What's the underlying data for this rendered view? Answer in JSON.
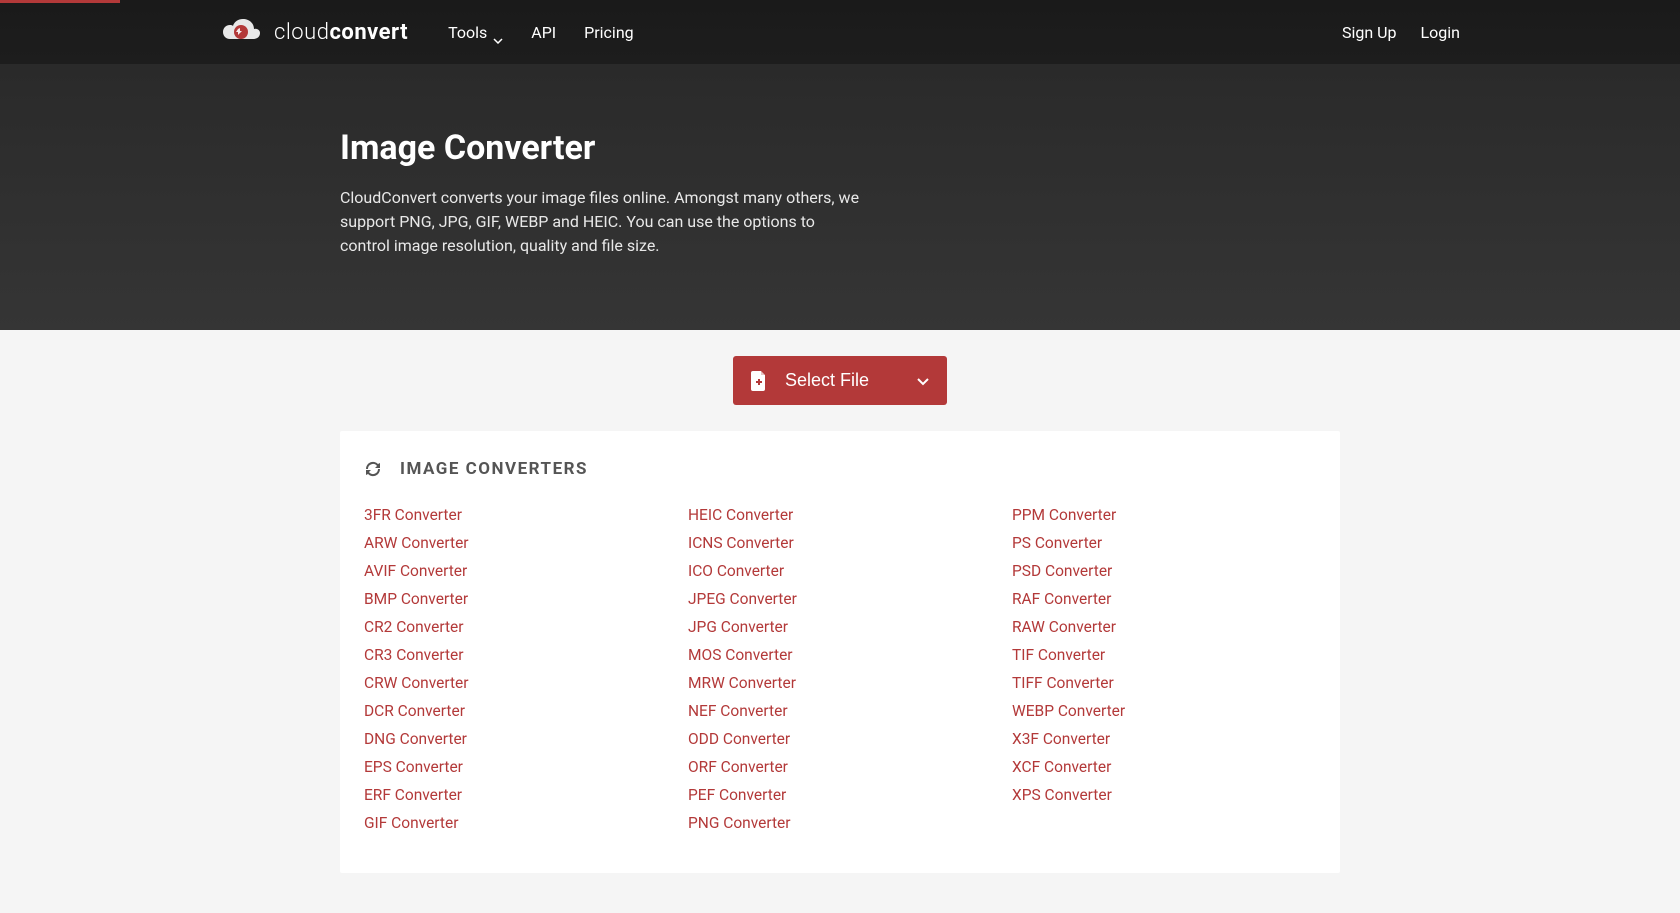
{
  "brand": {
    "light": "cloud",
    "bold": "convert"
  },
  "nav": {
    "tools": "Tools",
    "api": "API",
    "pricing": "Pricing",
    "signup": "Sign Up",
    "login": "Login"
  },
  "hero": {
    "title": "Image Converter",
    "description": "CloudConvert converts your image files online. Amongst many others, we support PNG, JPG, GIF, WEBP and HEIC. You can use the options to control image resolution, quality and file size."
  },
  "selectFile": "Select File",
  "section": {
    "title": "IMAGE CONVERTERS"
  },
  "converters": {
    "col1": [
      "3FR Converter",
      "ARW Converter",
      "AVIF Converter",
      "BMP Converter",
      "CR2 Converter",
      "CR3 Converter",
      "CRW Converter",
      "DCR Converter",
      "DNG Converter",
      "EPS Converter",
      "ERF Converter",
      "GIF Converter"
    ],
    "col2": [
      "HEIC Converter",
      "ICNS Converter",
      "ICO Converter",
      "JPEG Converter",
      "JPG Converter",
      "MOS Converter",
      "MRW Converter",
      "NEF Converter",
      "ODD Converter",
      "ORF Converter",
      "PEF Converter",
      "PNG Converter"
    ],
    "col3": [
      "PPM Converter",
      "PS Converter",
      "PSD Converter",
      "RAF Converter",
      "RAW Converter",
      "TIF Converter",
      "TIFF Converter",
      "WEBP Converter",
      "X3F Converter",
      "XCF Converter",
      "XPS Converter"
    ]
  }
}
